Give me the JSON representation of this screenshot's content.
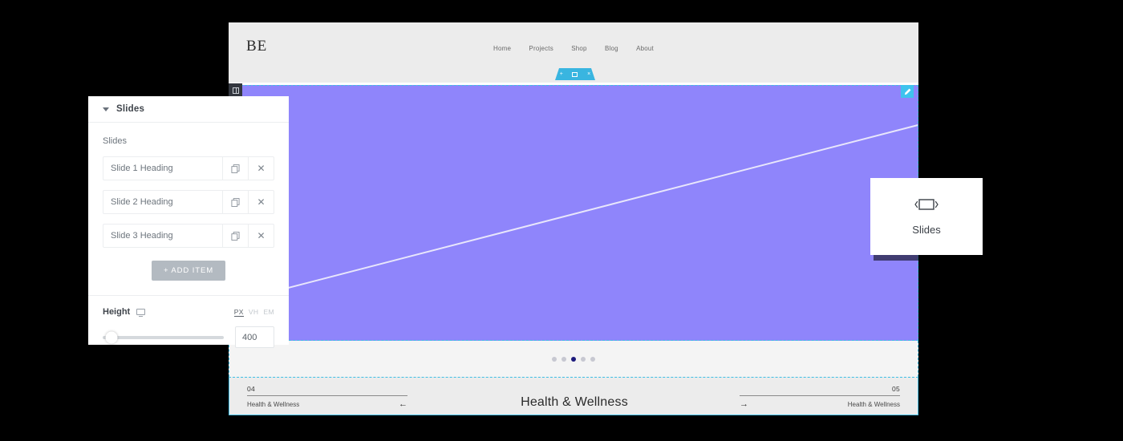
{
  "preview": {
    "header": {
      "logo": "BE",
      "nav": [
        {
          "label": "Home"
        },
        {
          "label": "Projects"
        },
        {
          "label": "Shop"
        },
        {
          "label": "Blog"
        },
        {
          "label": "About"
        }
      ]
    },
    "section_toolbar": {
      "add_label": "+",
      "columns_icon": "columns-icon",
      "close_label": "×"
    },
    "handles": {
      "element_handle_icon": "columns-handle-icon",
      "edit_handle_icon": "pencil-icon"
    },
    "carousel": {
      "dot_count": 5,
      "active_index": 2
    },
    "footer": {
      "left": {
        "number": "04",
        "caption": "Health & Wellness",
        "arrow": "←"
      },
      "right": {
        "number": "05",
        "caption": "Health & Wellness",
        "arrow": "→"
      },
      "title": "Health & Wellness"
    }
  },
  "widget_card": {
    "icon": "slides-carousel-icon",
    "label": "Slides"
  },
  "panel": {
    "title": "Slides",
    "collapse_icon": "caret-down-icon",
    "slides_label": "Slides",
    "rows": [
      {
        "label": "Slide 1 Heading",
        "duplicate_icon": "duplicate-icon",
        "remove_label": "✕"
      },
      {
        "label": "Slide 2 Heading",
        "duplicate_icon": "duplicate-icon",
        "remove_label": "✕"
      },
      {
        "label": "Slide 3 Heading",
        "duplicate_icon": "duplicate-icon",
        "remove_label": "✕"
      }
    ],
    "add_item_label": "+  ADD ITEM",
    "height": {
      "label": "Height",
      "device_icon": "desktop-icon",
      "units": [
        {
          "label": "PX",
          "active": true
        },
        {
          "label": "VH",
          "active": false
        },
        {
          "label": "EM",
          "active": false
        }
      ],
      "value": "400",
      "slider_percent": 7
    }
  },
  "colors": {
    "slide_background": "#8f85fb",
    "accent_cyan": "#3fbfe4",
    "toolbar_cyan": "#39b5e0",
    "active_dot": "#1c1a7c",
    "add_item_button": "#b3bac1",
    "panel_text": "#495157"
  }
}
